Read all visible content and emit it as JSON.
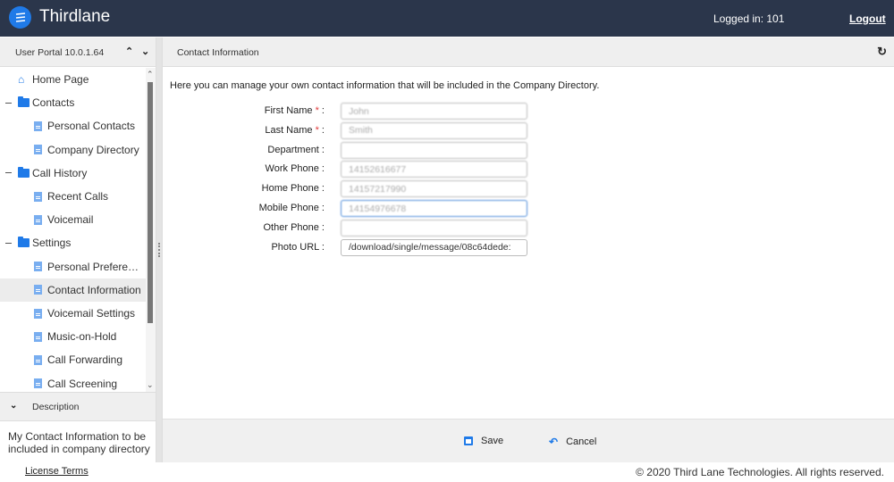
{
  "header": {
    "app_title": "Thirdlane",
    "logged_in": "Logged in: 101",
    "logout": "Logout",
    "logo_icon": "lines-icon"
  },
  "sidebar": {
    "title": "User Portal 10.0.1.64",
    "collapse_all_icon": "double-chevron-up-icon",
    "expand_all_icon": "double-chevron-down-icon",
    "tree": [
      {
        "label": "Home Page",
        "level": 1,
        "icon": "home-icon"
      },
      {
        "label": "Contacts",
        "level": 1,
        "icon": "folder-icon",
        "expanded": true
      },
      {
        "label": "Personal Contacts",
        "level": 2,
        "icon": "document-icon"
      },
      {
        "label": "Company Directory",
        "level": 2,
        "icon": "document-icon"
      },
      {
        "label": "Call History",
        "level": 1,
        "icon": "folder-icon",
        "expanded": true
      },
      {
        "label": "Recent Calls",
        "level": 2,
        "icon": "document-icon"
      },
      {
        "label": "Voicemail",
        "level": 2,
        "icon": "document-icon"
      },
      {
        "label": "Settings",
        "level": 1,
        "icon": "folder-icon",
        "expanded": true
      },
      {
        "label": "Personal Preferenc...",
        "level": 2,
        "icon": "document-icon"
      },
      {
        "label": "Contact Information",
        "level": 2,
        "icon": "document-icon",
        "selected": true
      },
      {
        "label": "Voicemail Settings",
        "level": 2,
        "icon": "document-icon"
      },
      {
        "label": "Music-on-Hold",
        "level": 2,
        "icon": "document-icon"
      },
      {
        "label": "Call Forwarding",
        "level": 2,
        "icon": "document-icon"
      },
      {
        "label": "Call Screening",
        "level": 2,
        "icon": "document-icon"
      }
    ],
    "description": {
      "title": "Description",
      "text": "My Contact Information to be included in company directory"
    }
  },
  "main": {
    "title": "Contact Information",
    "intro": "Here you can manage your own contact information that will be included in the Company Directory.",
    "fields": [
      {
        "label": "First Name",
        "required": true,
        "value": "John"
      },
      {
        "label": "Last Name",
        "required": true,
        "value": "Smith"
      },
      {
        "label": "Department",
        "required": false,
        "value": ""
      },
      {
        "label": "Work Phone",
        "required": false,
        "value": "14152616677"
      },
      {
        "label": "Home Phone",
        "required": false,
        "value": "14157217990"
      },
      {
        "label": "Mobile Phone",
        "required": false,
        "value": "14154976678",
        "focused": true
      },
      {
        "label": "Other Phone",
        "required": false,
        "value": ""
      },
      {
        "label": "Photo URL",
        "required": false,
        "value": "/download/single/message/08c64dede:"
      }
    ],
    "save_label": "Save",
    "cancel_label": "Cancel"
  },
  "footer": {
    "license": "License Terms",
    "copyright": "© 2020 Third Lane Technologies. All rights reserved."
  }
}
